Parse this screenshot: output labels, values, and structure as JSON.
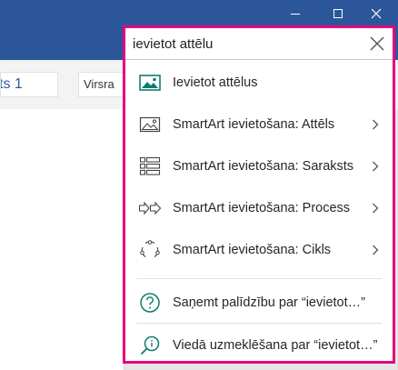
{
  "window": {
    "controls": [
      "minimize-icon",
      "maximize-icon",
      "close-icon"
    ]
  },
  "ribbon": {
    "style_partial_1": "ts 1",
    "style_partial_2": "Virsra"
  },
  "search": {
    "value": "ievietot attēlu",
    "clear_icon": "close-icon"
  },
  "results": [
    {
      "label": "Ievietot attēlus",
      "icon": "picture-icon",
      "submenu": false
    },
    {
      "label": "SmartArt ievietošana: Attēls",
      "icon": "smartart-picture-icon",
      "submenu": true
    },
    {
      "label": "SmartArt ievietošana: Saraksts",
      "icon": "smartart-list-icon",
      "submenu": true
    },
    {
      "label": "SmartArt ievietošana: Process",
      "icon": "smartart-process-icon",
      "submenu": true
    },
    {
      "label": "SmartArt ievietošana: Cikls",
      "icon": "smartart-cycle-icon",
      "submenu": true
    }
  ],
  "help": {
    "label": "Saņemt palīdzību par “ievietot…”",
    "icon": "help-icon"
  },
  "smart_lookup": {
    "label": "Viedā uzmeklēšana par “ievietot…”",
    "icon": "smart-lookup-icon"
  },
  "colors": {
    "titlebar": "#2b579a",
    "highlight_border": "#e4007e",
    "icon_teal": "#107c6e"
  }
}
